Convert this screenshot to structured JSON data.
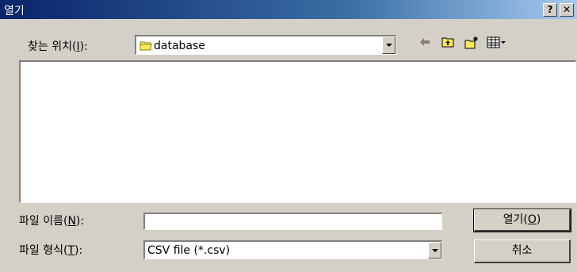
{
  "window": {
    "title": "열기",
    "help_glyph": "?",
    "close_glyph": "✕"
  },
  "look_in": {
    "label_pre": "찾는 위치(",
    "label_key": "I",
    "label_post": "):",
    "folder": "database",
    "folder_icon": "folder-icon"
  },
  "toolbar": {
    "back_icon": "back-arrow-icon",
    "up_icon": "up-folder-icon",
    "new_folder_icon": "new-folder-icon",
    "view_menu_icon": "view-menu-icon"
  },
  "file_name": {
    "label_pre": "파일 이름(",
    "label_key": "N",
    "label_post": "):",
    "value": ""
  },
  "file_type": {
    "label_pre": "파일 형식(",
    "label_key": "T",
    "label_post": "):",
    "selected": "CSV file (*.csv)"
  },
  "buttons": {
    "open_pre": "열기(",
    "open_key": "O",
    "open_post": ")",
    "cancel": "취소"
  },
  "colors": {
    "titlebar_start": "#0a246a",
    "titlebar_end": "#a6caf0",
    "dialog_bg": "#d4d0c8"
  }
}
